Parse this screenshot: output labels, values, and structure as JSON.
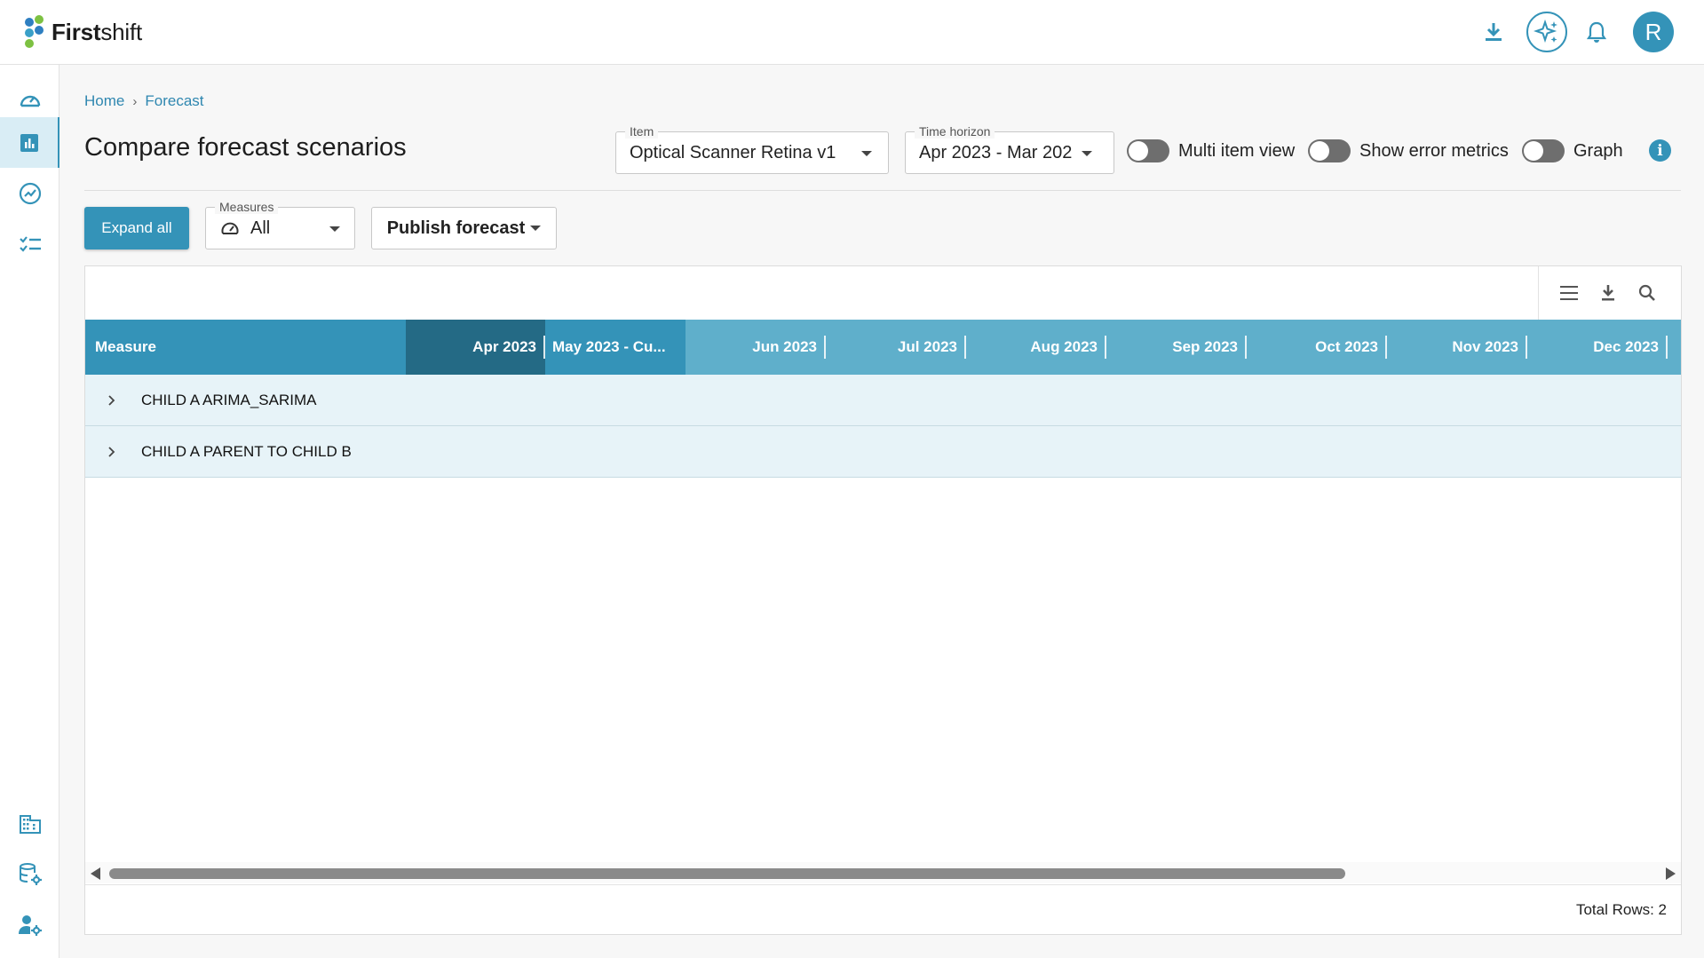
{
  "app": {
    "brand_bold": "First",
    "brand_light": "shift",
    "avatar_letter": "R"
  },
  "breadcrumb": {
    "home": "Home",
    "separator": "›",
    "current": "Forecast"
  },
  "page": {
    "title": "Compare forecast scenarios"
  },
  "filters": {
    "item": {
      "legend": "Item",
      "value": "Optical Scanner Retina v1"
    },
    "time_horizon": {
      "legend": "Time horizon",
      "value": "Apr 2023 - Mar 202"
    },
    "toggles": [
      {
        "label": "Multi item view",
        "on": false
      },
      {
        "label": "Show error metrics",
        "on": false
      },
      {
        "label": "Graph",
        "on": false
      }
    ]
  },
  "actions": {
    "expand_all": "Expand all",
    "measures": {
      "legend": "Measures",
      "value": "All"
    },
    "publish": "Publish forecast"
  },
  "grid": {
    "columns": [
      "Measure",
      "Apr 2023",
      "May 2023 - Cu...",
      "Jun 2023",
      "Jul 2023",
      "Aug 2023",
      "Sep 2023",
      "Oct 2023",
      "Nov 2023",
      "Dec 2023"
    ],
    "rows": [
      {
        "label": "CHILD A ARIMA_SARIMA"
      },
      {
        "label": "CHILD A PARENT TO CHILD B"
      }
    ],
    "footer": "Total Rows: 2"
  },
  "colors": {
    "accent": "#3493b8",
    "header_light": "#5fafcb",
    "header_dark": "#246a85",
    "row_bg": "#e7f3f8"
  }
}
